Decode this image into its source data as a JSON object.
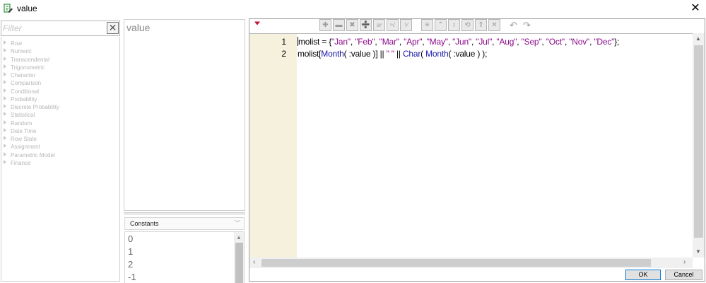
{
  "window": {
    "title": "value",
    "close_glyph": "✕",
    "icon": "formula-editor-icon"
  },
  "filter": {
    "placeholder": "Filter",
    "clear_glyph": "✕"
  },
  "function_categories": [
    "Row",
    "Numeric",
    "Transcendental",
    "Trigonometric",
    "Character",
    "Comparison",
    "Conditional",
    "Probability",
    "Discrete Probability",
    "Statistical",
    "Random",
    "Date Time",
    "Row State",
    "Assignment",
    "Parametric Model",
    "Finance"
  ],
  "column_panel": {
    "title": "value"
  },
  "constants": {
    "selected": "Constants",
    "items": [
      "0",
      "1",
      "2",
      "-1"
    ]
  },
  "editor": {
    "line_numbers": [
      "1",
      "2"
    ],
    "line1": {
      "var": "molist",
      "assign": " = {",
      "months": [
        "\"Jan\"",
        "\"Feb\"",
        "\"Mar\"",
        "\"Apr\"",
        "\"May\"",
        "\"Jun\"",
        "\"Jul\"",
        "\"Aug\"",
        "\"Sep\"",
        "\"Oct\"",
        "\"Nov\"",
        "\"Dec\""
      ],
      "sep": ", ",
      "end": "};"
    },
    "line2": {
      "var": "molist",
      "open": "[",
      "fn_month": "Month",
      "arg1": "( :value )] || ",
      "space_str": "\" \"",
      "concat": " || ",
      "fn_char": "Char",
      "paren_open": "( ",
      "fn_month2": "Month",
      "arg2": "( :value ) );"
    }
  },
  "toolbar": {
    "buttons": [
      "plus",
      "minus",
      "multiply",
      "divide",
      "power",
      "root",
      "fraction",
      "sign",
      "list",
      "up",
      "down",
      "swap",
      "local",
      "delete",
      "undo",
      "redo"
    ]
  },
  "buttons": {
    "ok": "OK",
    "cancel": "Cancel"
  }
}
